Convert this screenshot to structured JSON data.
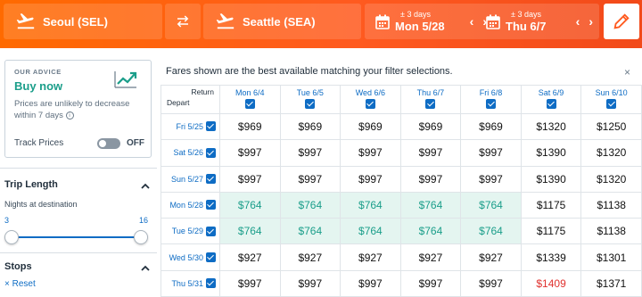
{
  "search": {
    "origin": "Seoul (SEL)",
    "destination": "Seattle (SEA)",
    "depart": {
      "flex": "± 3 days",
      "date": "Mon 5/28"
    },
    "return": {
      "flex": "± 3 days",
      "date": "Thu 6/7"
    },
    "prev_arrow": "‹",
    "next_arrow": "›",
    "accent": "#ff6a00"
  },
  "advice": {
    "label": "OUR ADVICE",
    "recommendation": "Buy now",
    "description": "Prices are unlikely to decrease within 7 days",
    "info_glyph": "i",
    "track_label": "Track Prices",
    "track_state": "OFF"
  },
  "filters": {
    "trip_length": {
      "title": "Trip Length",
      "subtitle": "Nights at destination",
      "min": "3",
      "max": "16"
    },
    "stops": {
      "title": "Stops",
      "reset": "× Reset"
    }
  },
  "matrix": {
    "note": "Fares shown are the best available matching your filter selections.",
    "close": "×",
    "corner_return": "Return",
    "corner_depart": "Depart",
    "return_dates": [
      "Mon 6/4",
      "Tue 6/5",
      "Wed 6/6",
      "Thu 6/7",
      "Fri 6/8",
      "Sat 6/9",
      "Sun 6/10"
    ],
    "rows": [
      {
        "depart": "Fri 5/25",
        "fares": [
          "$969",
          "$969",
          "$969",
          "$969",
          "$969",
          "$1320",
          "$1250"
        ]
      },
      {
        "depart": "Sat 5/26",
        "fares": [
          "$997",
          "$997",
          "$997",
          "$997",
          "$997",
          "$1390",
          "$1320"
        ]
      },
      {
        "depart": "Sun 5/27",
        "fares": [
          "$997",
          "$997",
          "$997",
          "$997",
          "$997",
          "$1390",
          "$1320"
        ]
      },
      {
        "depart": "Mon 5/28",
        "fares": [
          "$764",
          "$764",
          "$764",
          "$764",
          "$764",
          "$1175",
          "$1138"
        ]
      },
      {
        "depart": "Tue 5/29",
        "fares": [
          "$764",
          "$764",
          "$764",
          "$764",
          "$764",
          "$1175",
          "$1138"
        ]
      },
      {
        "depart": "Wed 5/30",
        "fares": [
          "$927",
          "$927",
          "$927",
          "$927",
          "$927",
          "$1339",
          "$1301"
        ]
      },
      {
        "depart": "Thu 5/31",
        "fares": [
          "$997",
          "$997",
          "$997",
          "$997",
          "$997",
          "$1409",
          "$1371"
        ]
      }
    ],
    "best_color": "#1b9e8a",
    "high_color": "#e0322f"
  }
}
